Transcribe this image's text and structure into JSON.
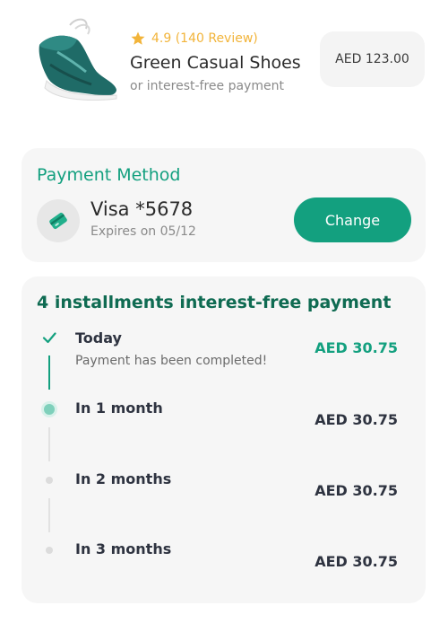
{
  "product": {
    "rating_text": "4.9 (140 Review)",
    "name": "Green Casual Shoes",
    "subtitle": "or interest-free payment",
    "price": "AED 123.00",
    "image_icon": "sneaker-icon"
  },
  "payment_method": {
    "title": "Payment Method",
    "card_name": "Visa *5678",
    "expires": "Expires on 05/12",
    "change_label": "Change",
    "card_icon": "credit-card-icon"
  },
  "installments": {
    "title": "4 installments interest-free payment",
    "steps": [
      {
        "label": "Today",
        "note": "Payment has been completed!",
        "amount": "AED 30.75",
        "status": "completed"
      },
      {
        "label": "In 1 month",
        "amount": "AED 30.75",
        "status": "next"
      },
      {
        "label": "In 2 months",
        "amount": "AED 30.75",
        "status": "upcoming"
      },
      {
        "label": "In 3 months",
        "amount": "AED 30.75",
        "status": "upcoming"
      }
    ]
  },
  "colors": {
    "accent": "#13a07f",
    "accent_dark": "#0f6b52",
    "star": "#f2b43a",
    "card_bg": "#f6f6f6"
  }
}
